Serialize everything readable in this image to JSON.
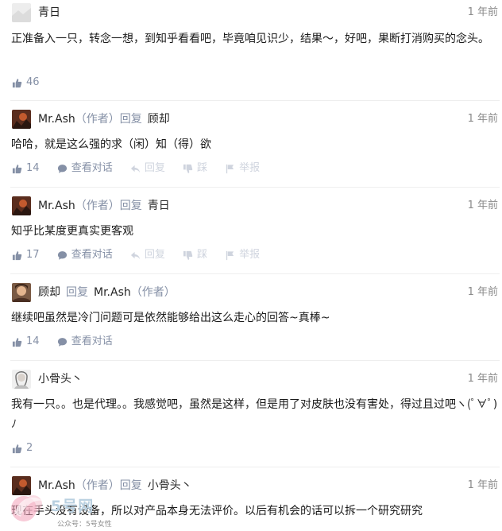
{
  "comments": [
    {
      "author": "青日",
      "time": "1 年前",
      "content": "正准备入一只，转念一想，到知乎看看吧，毕竟咱见识少，结果～，好吧，果断打消购买的念头。",
      "likes": "46"
    },
    {
      "author": "Mr.Ash",
      "author_tag": "（作者）",
      "reply_word": "回复",
      "reply_to": "顾却",
      "time": "1 年前",
      "content": "哈哈，就是这么强的求（闲）知（得）欲",
      "likes": "14",
      "actions": [
        "查看对话",
        "回复",
        "踩",
        "举报"
      ]
    },
    {
      "author": "Mr.Ash",
      "author_tag": "（作者）",
      "reply_word": "回复",
      "reply_to": "青日",
      "time": "1 年前",
      "content": "知乎比某度更真实更客观",
      "likes": "17",
      "actions": [
        "查看对话",
        "回复",
        "踩",
        "举报"
      ]
    },
    {
      "author": "顾却",
      "reply_word": "回复",
      "reply_to": "Mr.Ash",
      "reply_to_tag": "（作者）",
      "time": "1 年前",
      "content": "继续吧虽然是冷门问题可是依然能够给出这么走心的回答~真棒~",
      "likes": "14",
      "actions": [
        "查看对话"
      ]
    },
    {
      "author": "小骨头丶",
      "time": "1 年前",
      "content": "我有一只。。也是代理。。我感觉吧，虽然是这样，但是用了对皮肤也没有害处，得过且过吧ヽ(ﾟ∀ﾟ)ﾉ",
      "likes": "2"
    },
    {
      "author": "Mr.Ash",
      "author_tag": "（作者）",
      "reply_word": "回复",
      "reply_to": "小骨头丶",
      "time": "1 年前",
      "content": "现在手头没有设备，所以对产品本身无法评价。以后有机会的话可以拆一个研究研究"
    }
  ],
  "watermark": {
    "site": "5号网",
    "account": "公众号：5号女性"
  },
  "colors": {
    "meta": "#8590a6",
    "disabled": "#cfd4de",
    "divider": "#eeeeee"
  }
}
